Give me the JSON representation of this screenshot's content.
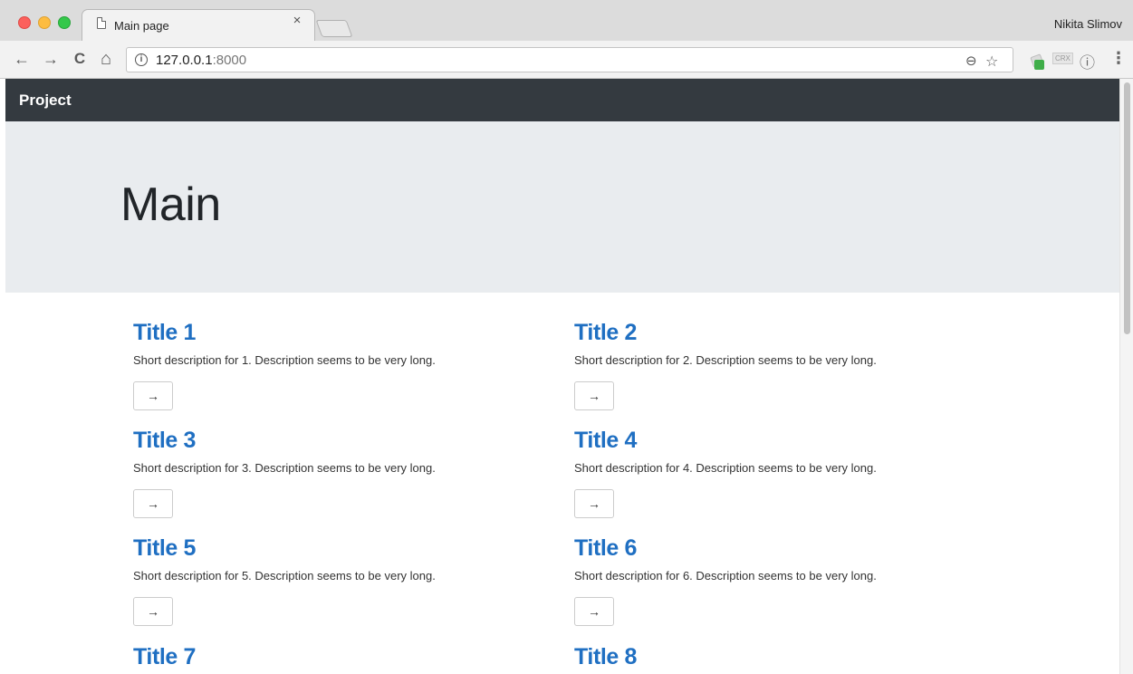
{
  "browser": {
    "tab_title": "Main page",
    "tab_close": "×",
    "profile_name": "Nikita Slimov",
    "url_host": "127.0.0.1",
    "url_port": ":8000",
    "icons": {
      "back": "←",
      "forward": "→",
      "reload": "C",
      "home": "⌂",
      "info": "i",
      "zoom": "⊖",
      "star": "☆",
      "menu": "⋮",
      "ext_info": "ⓘ"
    },
    "ext_labels": {
      "crx": "CRX"
    }
  },
  "navbar": {
    "brand": "Project"
  },
  "jumbotron": {
    "title": "Main"
  },
  "cards": [
    {
      "title": "Title 1",
      "description": "Short description for 1. Description seems to be very long.",
      "button": "→"
    },
    {
      "title": "Title 2",
      "description": "Short description for 2. Description seems to be very long.",
      "button": "→"
    },
    {
      "title": "Title 3",
      "description": "Short description for 3. Description seems to be very long.",
      "button": "→"
    },
    {
      "title": "Title 4",
      "description": "Short description for 4. Description seems to be very long.",
      "button": "→"
    },
    {
      "title": "Title 5",
      "description": "Short description for 5. Description seems to be very long.",
      "button": "→"
    },
    {
      "title": "Title 6",
      "description": "Short description for 6. Description seems to be very long.",
      "button": "→"
    },
    {
      "title": "Title 7"
    },
    {
      "title": "Title 8"
    }
  ],
  "colors": {
    "navbar": "#343a40",
    "jumbotron": "#e9ecef",
    "link": "#1f6fc2"
  }
}
